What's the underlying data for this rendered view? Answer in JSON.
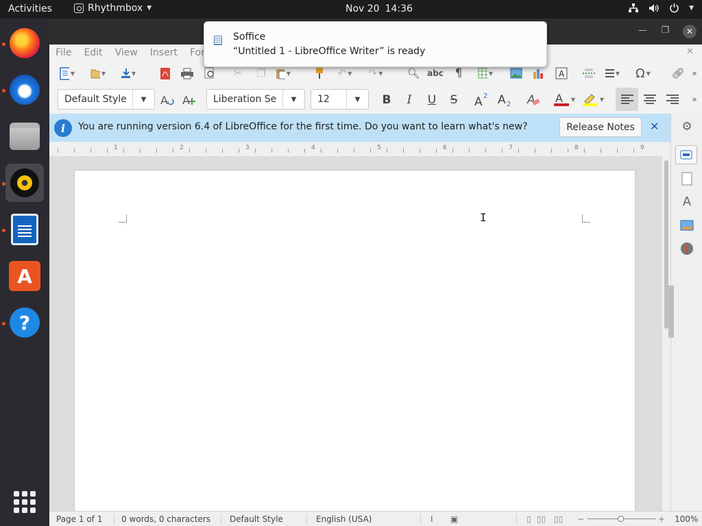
{
  "topbar": {
    "activities": "Activities",
    "app_name": "Rhythmbox",
    "date": "Nov 20",
    "time": "14:36"
  },
  "dock": {
    "items": [
      "firefox-icon",
      "thunderbird-icon",
      "files-icon",
      "rhythmbox-icon",
      "libreoffice-writer-icon",
      "ubuntu-software-icon",
      "help-icon"
    ],
    "show_apps": "show-applications-icon"
  },
  "notification": {
    "title": "Soffice",
    "body": "“Untitled 1 - LibreOffice Writer” is ready"
  },
  "menubar": {
    "items": [
      "File",
      "Edit",
      "View",
      "Insert",
      "Form"
    ]
  },
  "formatting": {
    "paragraph_style": "Default Style",
    "font_name": "Liberation Se",
    "font_size": "12",
    "bold": "B",
    "italic": "I",
    "underline": "U",
    "strike": "S"
  },
  "infobar": {
    "message": "You are running version 6.4 of LibreOffice for the first time. Do you want to learn what's new?",
    "button": "Release Notes",
    "info_glyph": "i"
  },
  "ruler": {
    "numbers": [
      "1",
      "2",
      "3",
      "4",
      "5",
      "6",
      "7",
      "8",
      "9"
    ]
  },
  "statusbar": {
    "page": "Page 1 of 1",
    "words": "0 words, 0 characters",
    "style": "Default Style",
    "language": "English (USA)",
    "zoom": "100%"
  },
  "colors": {
    "accent": "#e95420",
    "infobar_bg": "#bfe1f7",
    "font_color": "#c9211e",
    "highlight": "#ffff00"
  }
}
